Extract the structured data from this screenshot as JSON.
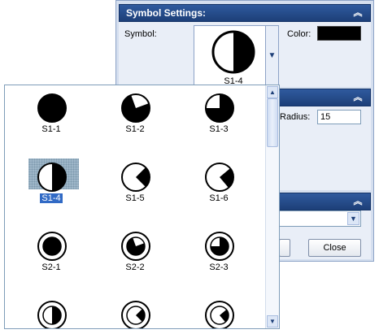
{
  "panels": {
    "symbol_settings": {
      "title": "Symbol Settings:"
    },
    "symbol_label": "Symbol:",
    "selected_symbol": "S1-4",
    "color_label": "Color:",
    "color_value": "#000000",
    "radius_label": "Radius:",
    "radius_value": "15",
    "close_label": "Close"
  },
  "symbol_list": {
    "items": [
      {
        "label": "S1-1",
        "ring": false,
        "fill": "full"
      },
      {
        "label": "S1-2",
        "ring": false,
        "fill": "three-quarter-b"
      },
      {
        "label": "S1-3",
        "ring": false,
        "fill": "three-quarter-c"
      },
      {
        "label": "S1-4",
        "ring": false,
        "fill": "half-right",
        "selected": true
      },
      {
        "label": "S1-5",
        "ring": false,
        "fill": "quarter"
      },
      {
        "label": "S1-6",
        "ring": false,
        "fill": "wedge"
      },
      {
        "label": "S2-1",
        "ring": true,
        "fill": "full"
      },
      {
        "label": "S2-2",
        "ring": true,
        "fill": "three-quarter-b"
      },
      {
        "label": "S2-3",
        "ring": true,
        "fill": "three-quarter-c"
      },
      {
        "label": "",
        "ring": true,
        "fill": "half-right"
      },
      {
        "label": "",
        "ring": true,
        "fill": "quarter"
      },
      {
        "label": "",
        "ring": true,
        "fill": "wedge"
      }
    ]
  },
  "colors": {
    "title_bar": "#1d3f78",
    "selection": "#316ac5"
  }
}
